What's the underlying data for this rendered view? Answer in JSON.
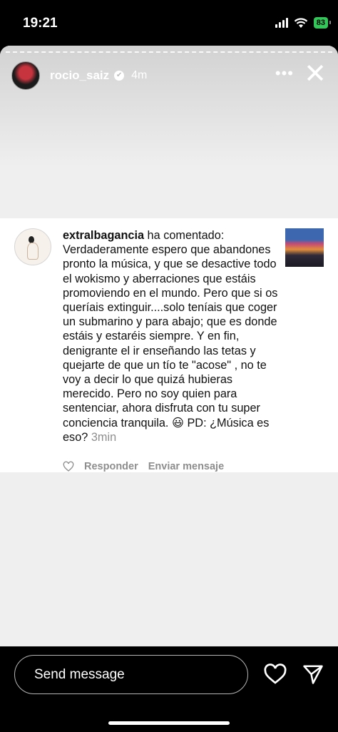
{
  "status_bar": {
    "time": "19:21",
    "battery": "83"
  },
  "story": {
    "username": "rocio_saiz",
    "time_ago": "4m",
    "menu_label": "•••",
    "close_label": "✕"
  },
  "comment": {
    "username": "extralbagancia",
    "action": " ha comentado: ",
    "body": "Verdaderamente espero que abandones pronto la música, y que se desactive todo el wokismo y aberraciones que estáis promoviendo en el mundo. Pero que si os queríais extinguir....solo teníais que coger un submarino y para abajo; que es donde estáis y estaréis siempre. Y en fin, denigrante el ir enseñando las tetas y quejarte de que un tío te \"acose\" , no te voy a decir lo que quizá hubieras merecido. Pero no soy quien para sentenciar, ahora disfruta con tu super conciencia tranquila. 😃 PD: ¿Música es eso?",
    "time_ago": "3min",
    "reply_label": "Responder",
    "send_message_label": "Enviar mensaje"
  },
  "bottom": {
    "message_placeholder": "Send message"
  },
  "icons": {
    "verified": "verified-badge-icon",
    "heart": "heart-icon",
    "send": "paper-plane-icon"
  }
}
